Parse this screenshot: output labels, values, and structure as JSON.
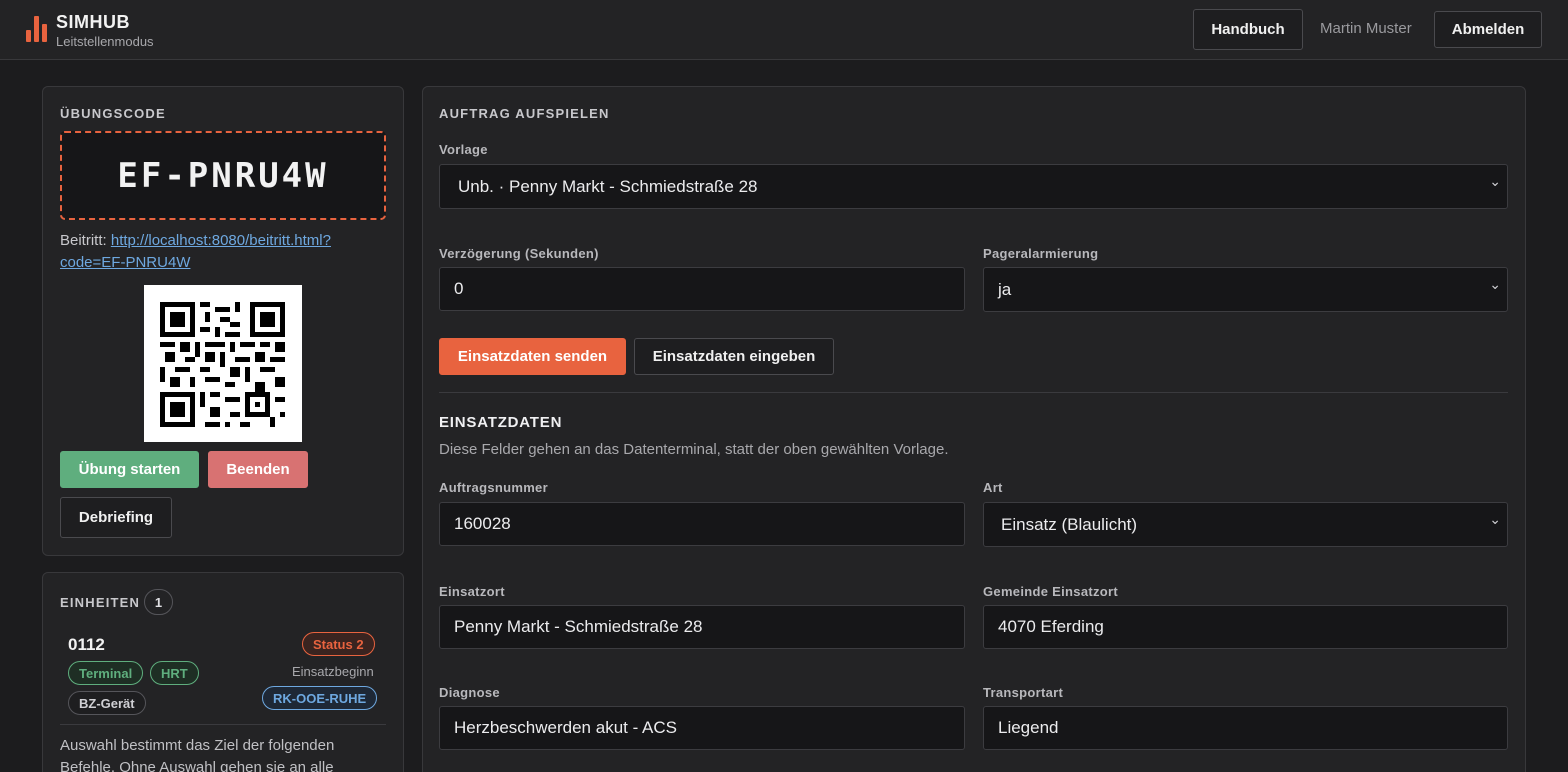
{
  "header": {
    "brand": "SIMHUB",
    "subtitle": "Leitstellenmodus",
    "manual_label": "Handbuch",
    "user_name": "Martin Muster",
    "logout_label": "Abmelden"
  },
  "exercise": {
    "section_title": "ÜBUNGSCODE",
    "code": "EF-PNRU4W",
    "join_prefix": "Beitritt:",
    "join_url": "http://localhost:8080/beitritt.html?code=EF-PNRU4W",
    "start_label": "Übung starten",
    "end_label": "Beenden",
    "debrief_label": "Debriefing"
  },
  "units": {
    "section_title": "EINHEITEN",
    "count": "1",
    "items": [
      {
        "name": "0112",
        "status": "Status 2",
        "tags": [
          "Terminal",
          "HRT",
          "BZ-Gerät"
        ],
        "phase": "Einsatzbeginn",
        "org": "RK-OOE-RUHE"
      }
    ],
    "hint": "Auswahl bestimmt das Ziel der folgenden Befehle. Ohne Auswahl gehen sie an alle"
  },
  "order": {
    "section_title": "AUFTRAG AUFSPIELEN",
    "template_label": "Vorlage",
    "template_value": "Unb. · Penny Markt - Schmiedstraße 28",
    "delay_label": "Verzögerung (Sekunden)",
    "delay_value": "0",
    "pager_label": "Pageralarmierung",
    "pager_value": "ja",
    "send_label": "Einsatzdaten senden",
    "enter_label": "Einsatzdaten eingeben"
  },
  "mission_data": {
    "title": "EINSATZDATEN",
    "description": "Diese Felder gehen an das Datenterminal, statt der oben gewählten Vorlage.",
    "order_number_label": "Auftragsnummer",
    "order_number_value": "160028",
    "type_label": "Art",
    "type_value": "Einsatz (Blaulicht)",
    "location_label": "Einsatzort",
    "location_value": "Penny Markt - Schmiedstraße 28",
    "municipality_label": "Gemeinde Einsatzort",
    "municipality_value": "4070 Eferding",
    "diagnosis_label": "Diagnose",
    "diagnosis_value": "Herzbeschwerden akut - ACS",
    "transport_label": "Transportart",
    "transport_value": "Liegend"
  },
  "colors": {
    "accent": "#e8633f",
    "success": "#5fae7e",
    "danger": "#d87272",
    "info": "#6ea8e0"
  }
}
